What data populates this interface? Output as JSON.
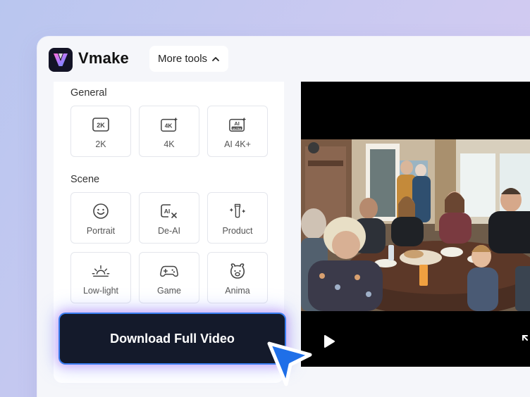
{
  "app": {
    "name": "Vmake",
    "logo_letter": "V"
  },
  "header": {
    "more_tools_label": "More tools"
  },
  "sections": {
    "general": {
      "title": "General",
      "items": [
        {
          "label": "2K",
          "icon": "2k-icon",
          "glyph": "2K"
        },
        {
          "label": "4K",
          "icon": "4k-icon",
          "glyph": "4K"
        },
        {
          "label": "AI 4K+",
          "icon": "ai-ultra-icon",
          "glyph": "AI",
          "subglyph": "ULTRA"
        }
      ]
    },
    "scene": {
      "title": "Scene",
      "items": [
        {
          "label": "Portrait",
          "icon": "smile-face-icon"
        },
        {
          "label": "De-AI",
          "icon": "de-ai-icon",
          "glyph": "AI"
        },
        {
          "label": "Product",
          "icon": "product-bottle-icon"
        },
        {
          "label": "Low-light",
          "icon": "sunrise-icon"
        },
        {
          "label": "Game",
          "icon": "gamepad-icon"
        },
        {
          "label": "Anima",
          "icon": "animal-face-icon"
        }
      ]
    }
  },
  "download_button": {
    "label": "Download Full Video"
  },
  "video": {
    "play_icon": "play-icon",
    "expand_icon": "expand-icon"
  },
  "colors": {
    "accent_blue": "#1f6fe8",
    "button_dark": "#141a2b"
  }
}
